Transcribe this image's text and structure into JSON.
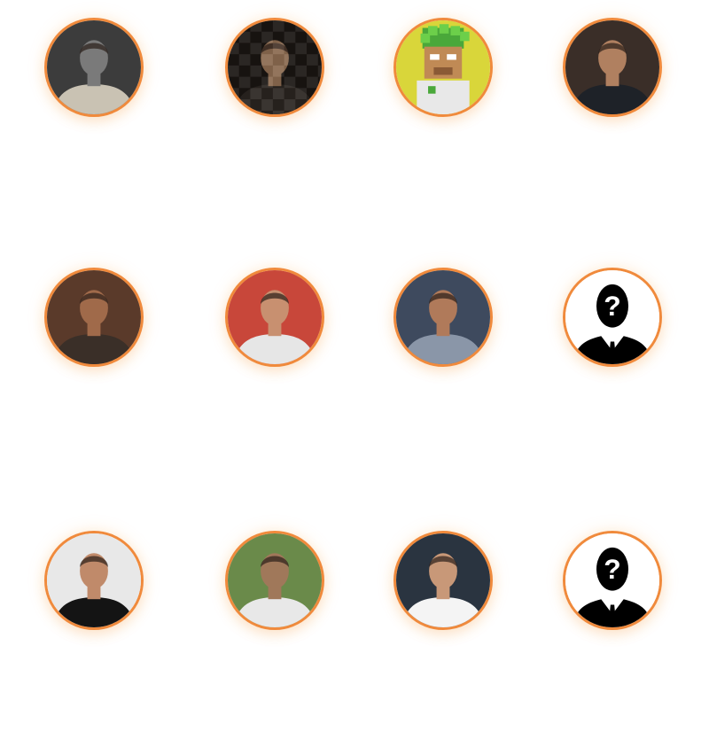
{
  "colors": {
    "ring": "#f08a3c",
    "background": "#ffffff"
  },
  "avatars": [
    {
      "icon": "person-photo-avatar",
      "tone": "#7a7a7a",
      "bg": "#3c3c3c",
      "shirt": "#c9c2b3"
    },
    {
      "icon": "pixelated-photo-avatar",
      "tone": "#8a6a50",
      "bg": "#1a1512",
      "shirt": "#2a2420"
    },
    {
      "icon": "pixel-ape-avatar",
      "tone": "#c08a55",
      "bg": "#d9d63a",
      "shirt": "#e8e8e8"
    },
    {
      "icon": "person-photo-avatar",
      "tone": "#b08060",
      "bg": "#3a2e28",
      "shirt": "#1e2228"
    },
    {
      "icon": "person-photo-avatar",
      "tone": "#a06a4a",
      "bg": "#5a3a2a",
      "shirt": "#3a2f28"
    },
    {
      "icon": "person-photo-avatar",
      "tone": "#c89070",
      "bg": "#c8473a",
      "shirt": "#e6e6e6"
    },
    {
      "icon": "person-photo-avatar",
      "tone": "#b07a5a",
      "bg": "#3e4a5e",
      "shirt": "#8a96a8"
    },
    {
      "icon": "mystery-person-icon",
      "tone": "#000000",
      "bg": "#ffffff",
      "shirt": "#000000"
    },
    {
      "icon": "person-photo-avatar",
      "tone": "#c08a6a",
      "bg": "#e8e8e8",
      "shirt": "#141414"
    },
    {
      "icon": "person-photo-avatar",
      "tone": "#a0785a",
      "bg": "#6a8a4a",
      "shirt": "#e8e8e8"
    },
    {
      "icon": "person-photo-avatar",
      "tone": "#c89878",
      "bg": "#2a3440",
      "shirt": "#f4f4f4"
    },
    {
      "icon": "mystery-person-icon",
      "tone": "#000000",
      "bg": "#ffffff",
      "shirt": "#000000"
    }
  ]
}
